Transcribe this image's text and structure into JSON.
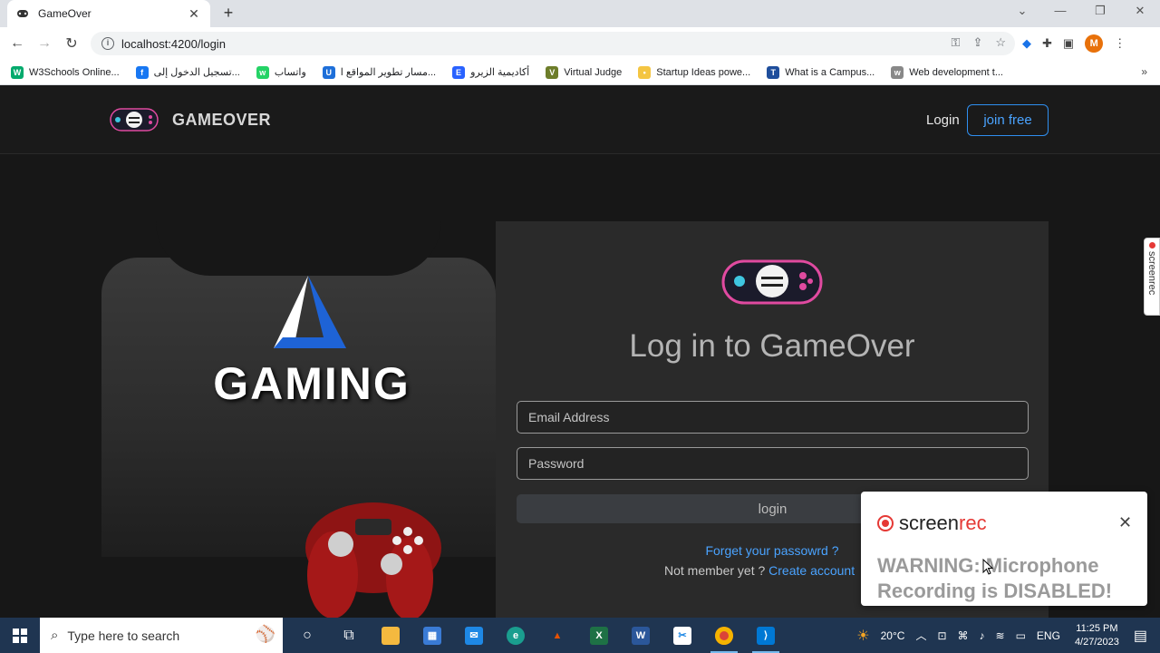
{
  "browser": {
    "tab_title": "GameOver",
    "url": "localhost:4200/login",
    "profile_initial": "M",
    "bookmarks": [
      {
        "label": "W3Schools Online...",
        "icon": "w3schools-icon",
        "color": "#04aa6d",
        "glyph": "W"
      },
      {
        "label": "تسجيل الدخول إلى...",
        "icon": "facebook-icon",
        "color": "#1877f2",
        "glyph": "f"
      },
      {
        "label": "واتساب",
        "icon": "whatsapp-icon",
        "color": "#25d366",
        "glyph": "w"
      },
      {
        "label": "مسار تطوير المواقع ا...",
        "icon": "udemy-icon",
        "color": "#1e6fd9",
        "glyph": "U"
      },
      {
        "label": "أكاديمية الزيرو",
        "icon": "e-icon",
        "color": "#2962ff",
        "glyph": "E"
      },
      {
        "label": "Virtual Judge",
        "icon": "vjudge-icon",
        "color": "#6d7d2a",
        "glyph": "V"
      },
      {
        "label": "Startup Ideas powe...",
        "icon": "bulb-icon",
        "color": "#f4c542",
        "glyph": "•"
      },
      {
        "label": "What is a Campus...",
        "icon": "shirt-icon",
        "color": "#1f4e9c",
        "glyph": "T"
      },
      {
        "label": "Web development t...",
        "icon": "w3c-icon",
        "color": "#888888",
        "glyph": "w"
      }
    ]
  },
  "site": {
    "brand": "GAMEOVER",
    "nav_login": "Login",
    "nav_join": "join free",
    "hero_word": "GAMING",
    "card_title": "Log in to GameOver",
    "email_placeholder": "Email Address",
    "password_placeholder": "Password",
    "login_button": "login",
    "forgot": "Forget your passowrd ?",
    "not_member": "Not member yet ?",
    "create_account": "Create account"
  },
  "screenrec": {
    "side_label": "screenrec",
    "brand_a": "screen",
    "brand_b": "rec",
    "warning": "WARNING: Microphone Recording is DISABLED!"
  },
  "taskbar": {
    "search_placeholder": "Type here to search",
    "weather": "20°C",
    "lang": "ENG",
    "time": "11:25 PM",
    "date": "4/27/2023"
  },
  "colors": {
    "accent_blue": "#4aa3ff",
    "card_bg": "#2a2a2a",
    "page_bg": "#171717"
  }
}
